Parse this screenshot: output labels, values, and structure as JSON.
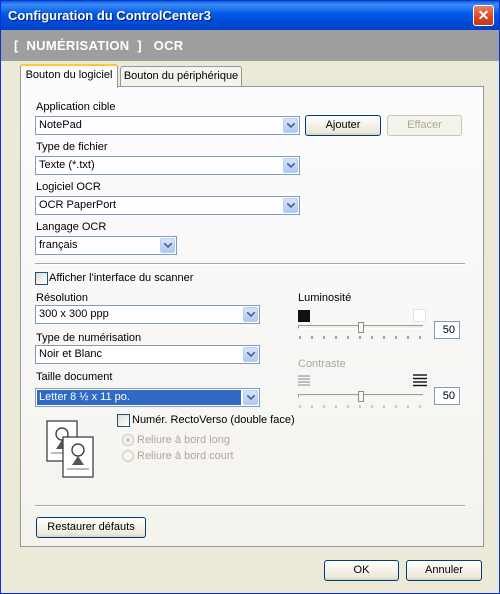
{
  "window": {
    "title": "Configuration du ControlCenter3",
    "close": "✕"
  },
  "header": {
    "text": "[  NUMÉRISATION  ]   OCR"
  },
  "tabs": [
    {
      "label": "Bouton du logiciel"
    },
    {
      "label": "Bouton du périphérique"
    }
  ],
  "app": {
    "label": "Application cible",
    "value": "NotePad",
    "add": "Ajouter",
    "delete": "Effacer"
  },
  "filetype": {
    "label": "Type de fichier",
    "value": "Texte (*.txt)"
  },
  "ocr": {
    "label": "Logiciel OCR",
    "value": "OCR PaperPort"
  },
  "language": {
    "label": "Langage OCR",
    "value": "français"
  },
  "scanner_ui": {
    "label": "Afficher l'interface du scanner"
  },
  "resolution": {
    "label": "Résolution",
    "value": "300 x 300 ppp"
  },
  "scantype": {
    "label": "Type de numérisation",
    "value": "Noir et Blanc"
  },
  "docsize": {
    "label": "Taille document",
    "value": "Letter 8 ½ x 11 po."
  },
  "brightness": {
    "label": "Luminosité",
    "value": "50",
    "level": 0.5
  },
  "contrast": {
    "label": "Contraste",
    "value": "50",
    "level": 0.5
  },
  "duplex": {
    "label": "Numér. RectoVerso (double face)",
    "long": "Reliure à bord long",
    "short": "Reliure à bord court"
  },
  "restore": "Restaurer défauts",
  "ok": "OK",
  "cancel": "Annuler"
}
